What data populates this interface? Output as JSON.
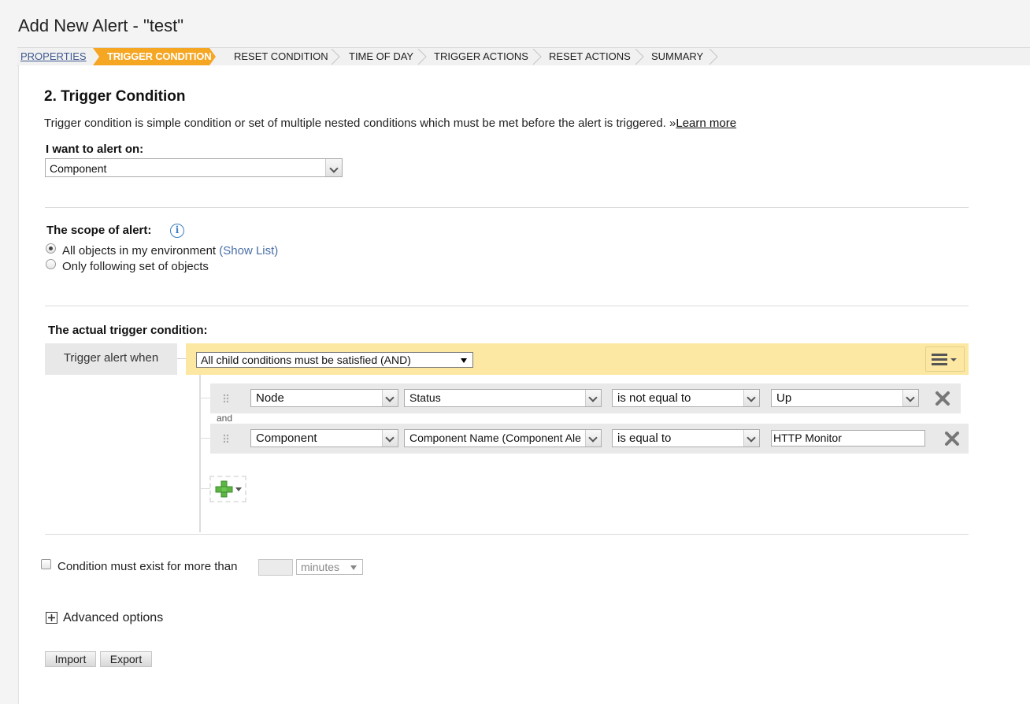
{
  "page": {
    "title": "Add New Alert - \"test\""
  },
  "wizard": {
    "steps": [
      "PROPERTIES",
      "TRIGGER CONDITION",
      "RESET CONDITION",
      "TIME OF DAY",
      "TRIGGER ACTIONS",
      "RESET ACTIONS",
      "SUMMARY"
    ],
    "active_color": "#f5a623"
  },
  "section": {
    "heading": "2. Trigger Condition",
    "description": "Trigger condition is simple condition or set of multiple nested conditions which must be met before the alert is triggered.",
    "learn_more_prefix": "»",
    "learn_more": "Learn more"
  },
  "alert_on": {
    "label": "I want to alert on:",
    "value": "Component"
  },
  "scope": {
    "label": "The scope of alert:",
    "info_icon": "info-icon",
    "options": [
      "All objects in my environment",
      "Only following set of objects"
    ],
    "show_list": "(Show List)",
    "selected": 0
  },
  "trigger": {
    "label": "The actual trigger condition:",
    "when_label": "Trigger alert when",
    "mode": "All child conditions must be satisfied (AND)",
    "bar_color": "#fce8a3",
    "conditions": [
      {
        "object": "Node",
        "property": "Status",
        "operator": "is not equal to",
        "value": "Up"
      },
      {
        "object": "Component",
        "property": "Component Name (Component Ale",
        "operator": "is equal to",
        "value": "HTTP Monitor"
      }
    ],
    "joiner": "and"
  },
  "duration": {
    "label": "Condition must exist for more than",
    "value": "",
    "unit": "minutes"
  },
  "advanced": {
    "label": "Advanced options"
  },
  "buttons": {
    "import": "Import",
    "export": "Export"
  }
}
